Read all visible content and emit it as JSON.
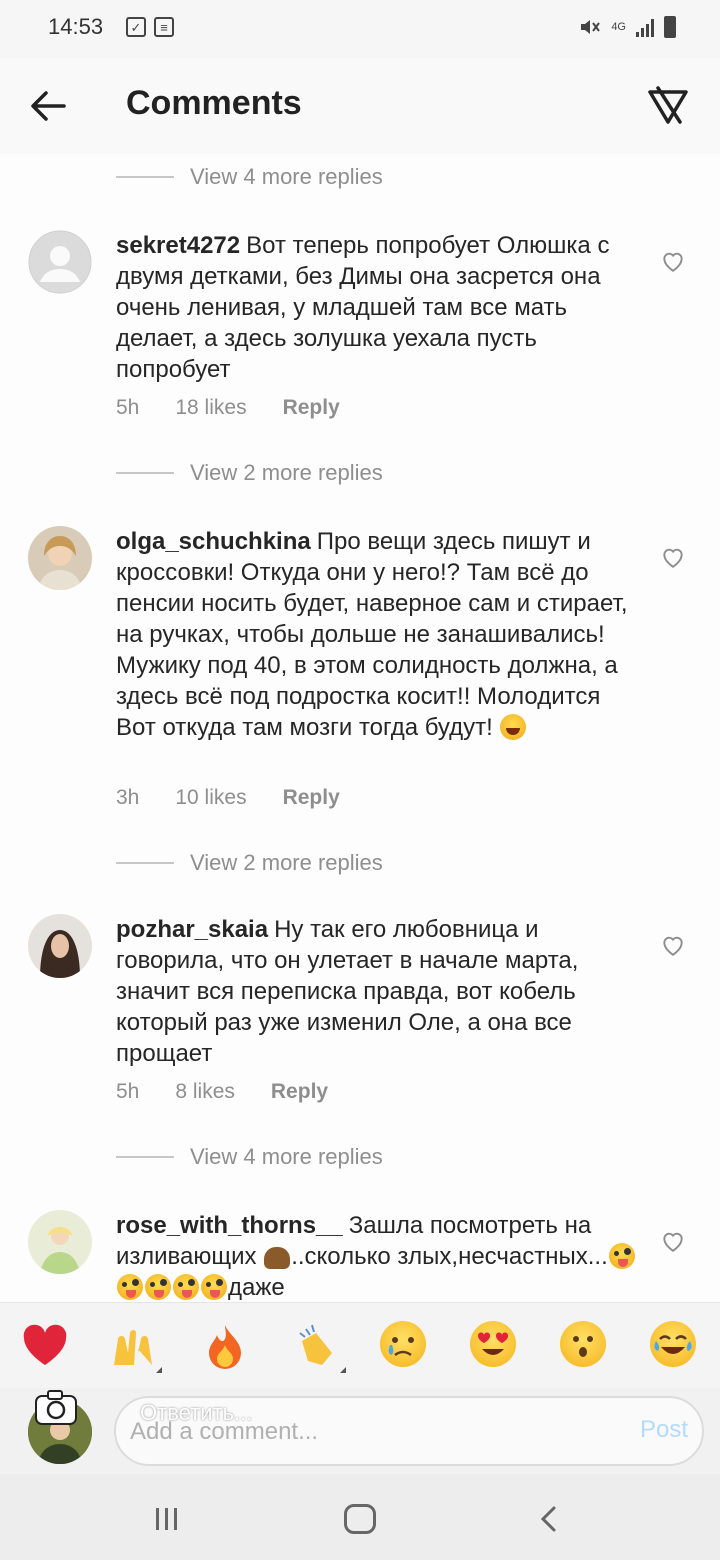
{
  "status_bar": {
    "time": "14:53",
    "network": "4G"
  },
  "header": {
    "title": "Comments",
    "back_icon": "arrow-left-icon",
    "share_icon": "send-filter-icon"
  },
  "view_replies": [
    "View 4 more replies",
    "View 2 more replies",
    "View 2 more replies",
    "View 4 more replies"
  ],
  "comments": [
    {
      "username": "sekret4272",
      "text": "Вот теперь попробует Олюшка с двумя детками, без Димы она засрется она очень ленивая, у младшей там все мать делает, а здесь золушка уехала пусть попробует",
      "time": "5h",
      "likes": "18 likes",
      "reply": "Reply"
    },
    {
      "username": "olga_schuchkina",
      "text": "Про вещи здесь пишут и кроссовки! Откуда они у него!? Там всё до пенсии носить будет, наверное сам и стирает, на ручках, чтобы дольше не занашивались! Мужику под 40, в этом солидность должна, а здесь всё под подростка косит!! Молодится Вот откуда там мозги тогда будут!",
      "time": "3h",
      "likes": "10 likes",
      "reply": "Reply"
    },
    {
      "username": "pozhar_skaia",
      "text": "Ну так его любовница и говорила, что он улетает в начале марта, значит вся переписка правда, вот кобель который раз уже изменил Оле, а она все прощает",
      "time": "5h",
      "likes": "8 likes",
      "reply": "Reply"
    },
    {
      "username": "rose_with_thorns__",
      "text_part1": "Зашла посмотреть на изливающих",
      "text_part2": "..сколько злых,несчастных...",
      "text_part3": "даже"
    }
  ],
  "reactions": [
    "red-heart",
    "raising-hands",
    "fire",
    "clapping-hands",
    "crying-face",
    "heart-eyes",
    "astonished-face",
    "tears-of-joy"
  ],
  "input": {
    "placeholder": "Add a comment...",
    "overlay": "Ответить...",
    "post": "Post"
  },
  "colors": {
    "accent_disabled": "#b3dbff",
    "secondary_text": "#8e8e8e",
    "heart": "#e0243a"
  }
}
